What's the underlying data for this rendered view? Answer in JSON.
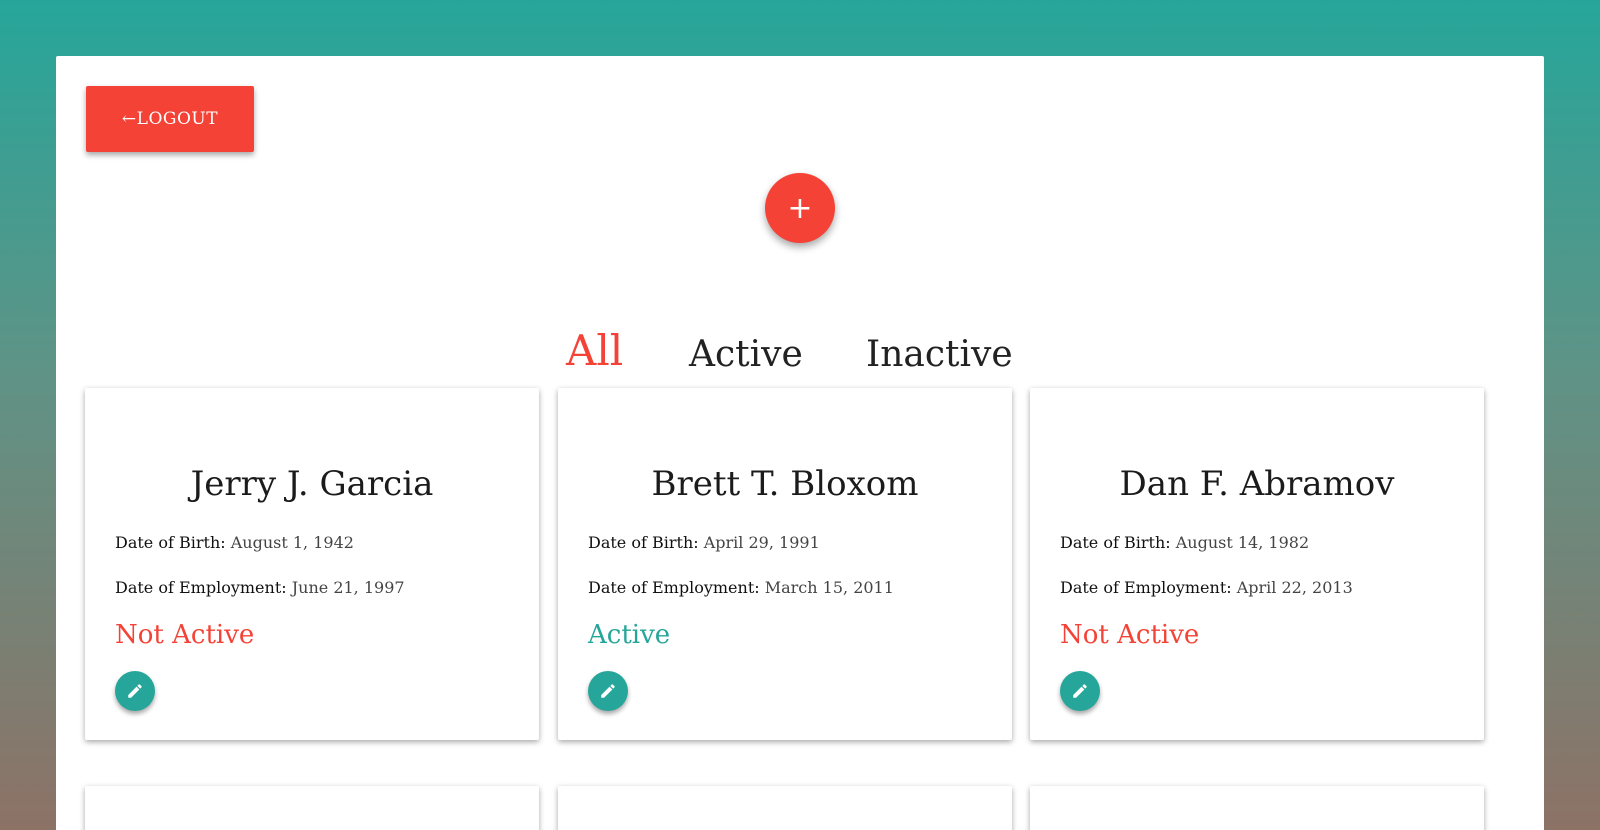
{
  "header": {
    "logout_label": "LOGOUT",
    "logout_arrow": "←",
    "add_label": "+"
  },
  "tabs": [
    {
      "label": "All",
      "selected": true
    },
    {
      "label": "Active",
      "selected": false
    },
    {
      "label": "Inactive",
      "selected": false
    }
  ],
  "labels": {
    "dob": "Date of Birth:",
    "doe": "Date of Employment:"
  },
  "employees": [
    {
      "name": "Jerry J. Garcia",
      "dob": "August 1, 1942",
      "doe": "June 21, 1997",
      "status": "Not Active",
      "status_color": "#f44336"
    },
    {
      "name": "Brett T. Bloxom",
      "dob": "April 29, 1991",
      "doe": "March 15, 2011",
      "status": "Active",
      "status_color": "#26a69a"
    },
    {
      "name": "Dan F. Abramov",
      "dob": "August 14, 1982",
      "doe": "April 22, 2013",
      "status": "Not Active",
      "status_color": "#f44336"
    }
  ],
  "colors": {
    "accent": "#f44336",
    "teal": "#26a69a"
  },
  "icons": {
    "edit": "pencil-icon",
    "add": "plus-icon",
    "logout": "arrow-left-icon"
  }
}
